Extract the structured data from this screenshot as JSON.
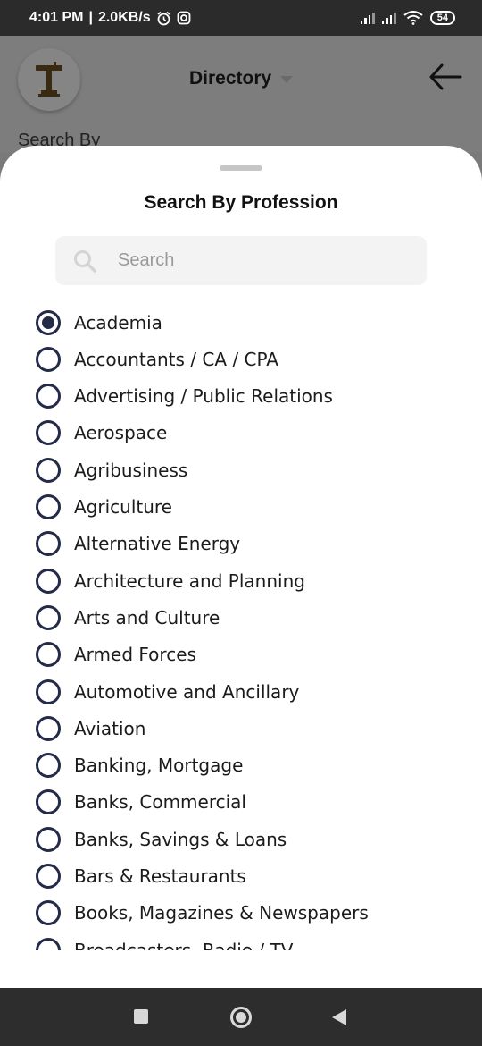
{
  "status_bar": {
    "time": "4:01 PM",
    "speed": "2.0KB/s",
    "battery": "54"
  },
  "header": {
    "title": "Directory",
    "behind_label": "Search By"
  },
  "sheet": {
    "title": "Search By Profession",
    "search_placeholder": "Search",
    "selected_index": 0,
    "items": [
      {
        "label": "Academia"
      },
      {
        "label": "Accountants / CA / CPA"
      },
      {
        "label": "Advertising / Public Relations"
      },
      {
        "label": "Aerospace"
      },
      {
        "label": "Agribusiness"
      },
      {
        "label": "Agriculture"
      },
      {
        "label": "Alternative Energy"
      },
      {
        "label": "Architecture and Planning"
      },
      {
        "label": "Arts and Culture"
      },
      {
        "label": "Armed Forces"
      },
      {
        "label": "Automotive and Ancillary"
      },
      {
        "label": "Aviation"
      },
      {
        "label": "Banking, Mortgage"
      },
      {
        "label": "Banks, Commercial"
      },
      {
        "label": "Banks, Savings & Loans"
      },
      {
        "label": "Bars & Restaurants"
      },
      {
        "label": "Books, Magazines & Newspapers"
      },
      {
        "label": "Broadcasters, Radio / TV"
      }
    ]
  },
  "colors": {
    "radio_accent": "#242b48",
    "status_bar": "#2b2b2b",
    "nav_bar": "#2d2d2d",
    "scrim": "#7a7a7a"
  },
  "icons": {
    "alarm": "alarm-clock-icon",
    "instagram": "instagram-icon",
    "signal": "signal-icon",
    "wifi": "wifi-icon",
    "search": "search-icon",
    "back": "back-arrow-icon",
    "logo": "pillar-logo-icon"
  }
}
